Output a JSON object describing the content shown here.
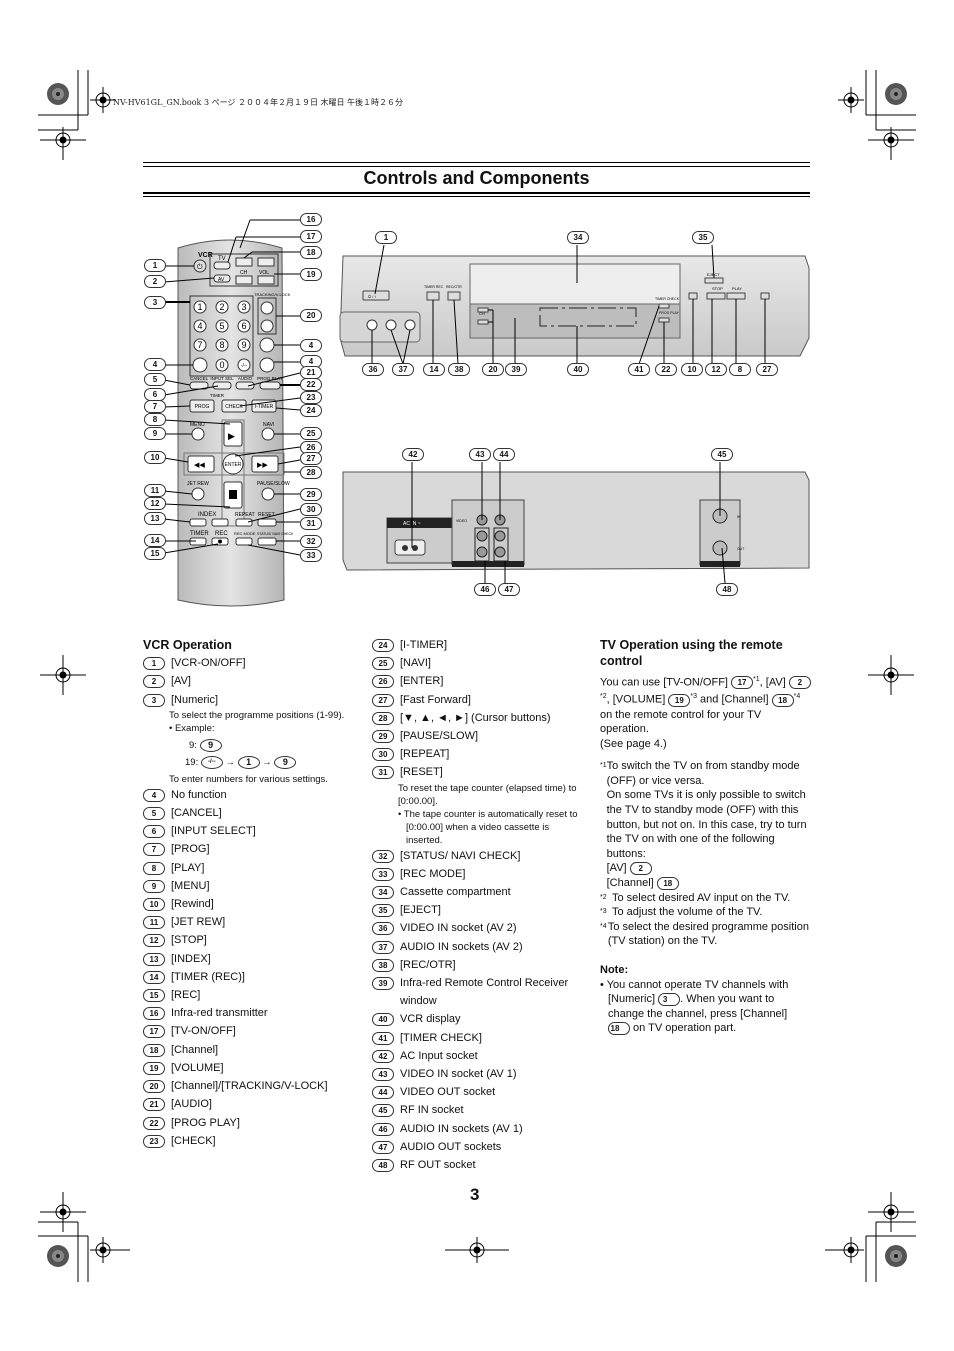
{
  "print_header": "NV-HV61GL_GN.book  3 ページ  ２００４年２月１９日  木曜日  午後１時２６分",
  "page_title": "Controls and Components",
  "page_number": "3",
  "remote": {
    "labels": {
      "vcr": "VCR",
      "tv": "TV",
      "av": "AV",
      "ch": "CH",
      "vol": "VOL",
      "tracking": "TRACKING/V-LOCK",
      "numeric_keys": [
        "1",
        "2",
        "3",
        "4",
        "5",
        "6",
        "7",
        "8",
        "9",
        "0",
        "-/--"
      ],
      "cancel": "CANCEL",
      "input_sel": "INPUT SEL",
      "audio": "AUDIO",
      "prog_play": "PROG PLAY",
      "timer": "TIMER",
      "prog": "PROG",
      "check": "CHECK",
      "i_timer": "I-TIMER",
      "menu": "MENU",
      "navi": "NAVI",
      "enter": "ENTER",
      "jet_rew": "JET REW",
      "pause_slow": "PAUSE/SLOW",
      "index": "INDEX",
      "repeat": "REPEAT",
      "reset": "RESET",
      "timer_rec": "TIMER",
      "rec": "REC",
      "rec_mode": "REC MODE",
      "status_navi": "STATUS/ NAVI CHECK"
    },
    "callouts_left": [
      "1",
      "2",
      "3",
      "4",
      "5",
      "6",
      "7",
      "8",
      "9",
      "10",
      "11",
      "12",
      "13",
      "14",
      "15"
    ],
    "callouts_right": [
      "16",
      "17",
      "18",
      "19",
      "20",
      "4",
      "4",
      "21",
      "22",
      "23",
      "24",
      "25",
      "26",
      "27",
      "28",
      "29",
      "30",
      "31",
      "32",
      "33"
    ]
  },
  "front_panel": {
    "labels": {
      "power": "⏻ / I",
      "timer_rec": "TIMER REC",
      "rec_otr": "REC/OTR",
      "ch": "CH",
      "eject": "EJECT",
      "stop": "STOP",
      "play": "PLAY",
      "timer_check": "TIMER CHECK",
      "prog_play": "PROG PLAY"
    },
    "callouts_top": [
      "1",
      "34",
      "35"
    ],
    "callouts_bottom": [
      "36",
      "37",
      "14",
      "38",
      "20",
      "39",
      "40",
      "41",
      "22",
      "10",
      "12",
      "8",
      "27"
    ]
  },
  "rear_panel": {
    "labels": {
      "ac_in": "AC IN ~",
      "video": "VIDEO",
      "audio": "AUDIO",
      "l": "L",
      "r": "R",
      "in_line1": "IN LINE1",
      "out": "OUT",
      "rf_in": "IN",
      "rf_out": "OUT"
    },
    "callouts_top": [
      "42",
      "43",
      "44",
      "45"
    ],
    "callouts_bottom": [
      "46",
      "47",
      "48"
    ]
  },
  "vcr_operation": {
    "heading": "VCR Operation",
    "items_col1": [
      {
        "n": "1",
        "label": "[VCR-ON/OFF]"
      },
      {
        "n": "2",
        "label": "[AV]"
      },
      {
        "n": "3",
        "label": "[Numeric]"
      },
      {
        "n": "4",
        "label": "No function"
      },
      {
        "n": "5",
        "label": "[CANCEL]"
      },
      {
        "n": "6",
        "label": "[INPUT SELECT]"
      },
      {
        "n": "7",
        "label": "[PROG]"
      },
      {
        "n": "8",
        "label": "[PLAY]"
      },
      {
        "n": "9",
        "label": "[MENU]"
      },
      {
        "n": "10",
        "label": "[Rewind]"
      },
      {
        "n": "11",
        "label": "[JET REW]"
      },
      {
        "n": "12",
        "label": "[STOP]"
      },
      {
        "n": "13",
        "label": "[INDEX]"
      },
      {
        "n": "14",
        "label": "[TIMER (REC)]"
      },
      {
        "n": "15",
        "label": "[REC]"
      },
      {
        "n": "16",
        "label": "Infra-red transmitter"
      },
      {
        "n": "17",
        "label": "[TV-ON/OFF]"
      },
      {
        "n": "18",
        "label": "[Channel]"
      },
      {
        "n": "19",
        "label": "[VOLUME]"
      },
      {
        "n": "20",
        "label": "[Channel]/[TRACKING/V-LOCK]"
      },
      {
        "n": "21",
        "label": "[AUDIO]"
      },
      {
        "n": "22",
        "label": "[PROG PLAY]"
      },
      {
        "n": "23",
        "label": "[CHECK]"
      }
    ],
    "numeric_note": "To select the programme positions (1-99).",
    "example_label": "• Example:",
    "example_9": "9:",
    "example_19": "19:",
    "key_9": "9",
    "key_1": "1",
    "key_dash": "-/--",
    "arrow": "→",
    "numeric_note2": "To enter numbers for various settings.",
    "items_col2": [
      {
        "n": "24",
        "label": "[I-TIMER]"
      },
      {
        "n": "25",
        "label": "[NAVI]"
      },
      {
        "n": "26",
        "label": "[ENTER]"
      },
      {
        "n": "27",
        "label": "[Fast Forward]"
      },
      {
        "n": "28",
        "label": "[▼, ▲, ◄, ►] (Cursor buttons)"
      },
      {
        "n": "29",
        "label": "[PAUSE/SLOW]"
      },
      {
        "n": "30",
        "label": "[REPEAT]"
      },
      {
        "n": "31",
        "label": "[RESET]"
      },
      {
        "n": "32",
        "label": "[STATUS/ NAVI CHECK]"
      },
      {
        "n": "33",
        "label": "[REC MODE]"
      },
      {
        "n": "34",
        "label": "Cassette compartment"
      },
      {
        "n": "35",
        "label": "[EJECT]"
      },
      {
        "n": "36",
        "label": "VIDEO IN socket (AV 2)"
      },
      {
        "n": "37",
        "label": "AUDIO IN sockets (AV 2)"
      },
      {
        "n": "38",
        "label": "[REC/OTR]"
      },
      {
        "n": "39",
        "label": "Infra-red Remote Control Receiver window"
      },
      {
        "n": "40",
        "label": "VCR display"
      },
      {
        "n": "41",
        "label": "[TIMER CHECK]"
      },
      {
        "n": "42",
        "label": "AC Input socket"
      },
      {
        "n": "43",
        "label": "VIDEO IN socket (AV 1)"
      },
      {
        "n": "44",
        "label": "VIDEO OUT socket"
      },
      {
        "n": "45",
        "label": "RF IN socket"
      },
      {
        "n": "46",
        "label": "AUDIO IN sockets (AV 1)"
      },
      {
        "n": "47",
        "label": "AUDIO OUT sockets"
      },
      {
        "n": "48",
        "label": "RF OUT socket"
      }
    ],
    "reset_note": "To reset the tape counter (elapsed time) to [0:00.00].",
    "reset_bullet": "• The tape counter is automatically reset to [0:00.00] when a video cassette is inserted."
  },
  "tv_operation": {
    "heading": "TV Operation using the remote control",
    "intro_1": "You can use [TV-ON/OFF]",
    "intro_n17": "17",
    "intro_2": ", [AV]",
    "intro_n2": "2",
    "intro_3": ", [VOLUME]",
    "intro_n19": "19",
    "intro_4": " and [Channel]",
    "intro_n18": "18",
    "intro_5": " on the remote control for your TV operation.",
    "see_page": "(See page 4.)",
    "fn1_mark": "*1",
    "fn1_text": "To switch the TV on from standby mode (OFF) or vice versa.",
    "fn1_more": "On some TVs it is only possible to switch the TV to standby mode (OFF) with this button, but not on. In this case, try to turn the TV on with one of the following buttons:",
    "fn1_av": "[AV]",
    "fn1_av_n": "2",
    "fn1_ch": "[Channel]",
    "fn1_ch_n": "18",
    "fn2_mark": "*2",
    "fn2_text": "To select desired AV input on the TV.",
    "fn3_mark": "*3",
    "fn3_text": "To adjust the volume of the TV.",
    "fn4_mark": "*4",
    "fn4_text": "To select the desired programme position (TV station) on the TV.",
    "note_heading": "Note:",
    "note_1": "• You cannot operate TV channels with [Numeric]",
    "note_n3": "3",
    "note_2": ". When you want to change the channel, press [Channel]",
    "note_n18": "18",
    "note_3": " on TV operation part."
  }
}
